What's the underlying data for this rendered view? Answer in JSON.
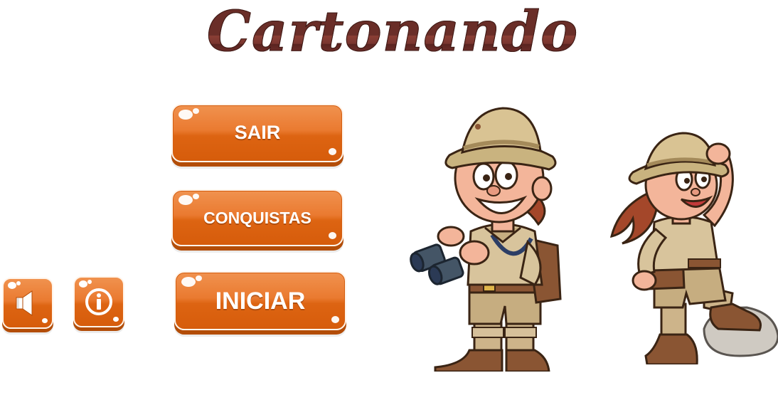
{
  "game": {
    "title": "Cartonando"
  },
  "menu": {
    "exit_label": "SAIR",
    "achievements_label": "CONQUISTAS",
    "start_label": "INICIAR"
  },
  "icons": {
    "sound": "speaker-icon",
    "info": "info-icon"
  },
  "colors": {
    "button_orange": "#e8722a",
    "button_dark": "#b34d08",
    "title_brown": "#6a2e28",
    "background": "#ffffff"
  }
}
